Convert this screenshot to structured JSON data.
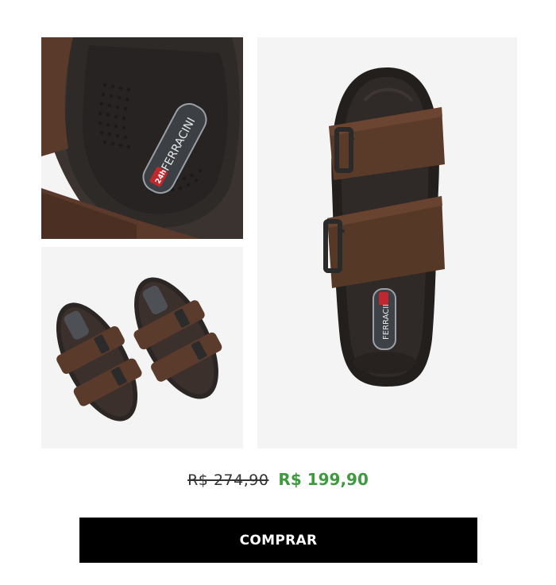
{
  "product": {
    "brand_logo_text": "FERRACINI",
    "brand_logo_sub": "24h"
  },
  "pricing": {
    "old_price": "R$ 274,90",
    "new_price": "R$ 199,90",
    "new_price_color": "#3e9a3e"
  },
  "cta": {
    "label": "COMPRAR",
    "background": "#000000",
    "text_color": "#ffffff"
  },
  "gallery": {
    "images": [
      {
        "name": "insole-closeup-photo",
        "icon": "sandal-insole-detail"
      },
      {
        "name": "sandal-pair-photo",
        "icon": "sandal-pair"
      },
      {
        "name": "sandal-top-view-photo",
        "icon": "sandal-top-view"
      }
    ]
  }
}
